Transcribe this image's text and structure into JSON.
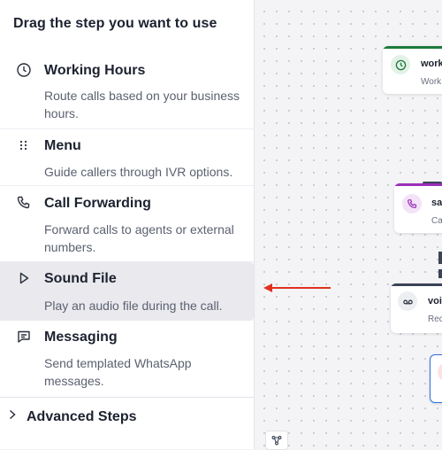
{
  "sidebar": {
    "title": "Drag the step you want to use",
    "steps": [
      {
        "name": "Working Hours",
        "description": "Route calls based on your business hours.",
        "icon": "clock-icon"
      },
      {
        "name": "Menu",
        "description": "Guide callers through IVR options.",
        "icon": "dial-pad-icon"
      },
      {
        "name": "Call Forwarding",
        "description": "Forward calls to agents or external numbers.",
        "icon": "phone-icon"
      },
      {
        "name": "Sound File",
        "description": "Play an audio file during the call.",
        "icon": "play-icon",
        "selected": true
      },
      {
        "name": "Messaging",
        "description": "Send templated WhatsApp messages.",
        "icon": "message-icon"
      }
    ],
    "advanced_label": "Advanced Steps"
  },
  "canvas": {
    "nodes": [
      {
        "title": "work",
        "subtitle": "Work",
        "icon": "clock-icon",
        "accent": "#1e7a3c"
      },
      {
        "title": "sa",
        "subtitle": "Ca",
        "icon": "phone-icon",
        "accent": "#9b2fb8"
      },
      {
        "title": "voi",
        "subtitle": "Rec",
        "icon": "voicemail-icon",
        "accent": "#3a4356"
      },
      {
        "title": "",
        "subtitle": "",
        "icon": "",
        "accent": "#2f6fe0"
      }
    ]
  },
  "colors": {
    "arrow": "#e0311f",
    "selected_bg": "#e9e9ee"
  }
}
